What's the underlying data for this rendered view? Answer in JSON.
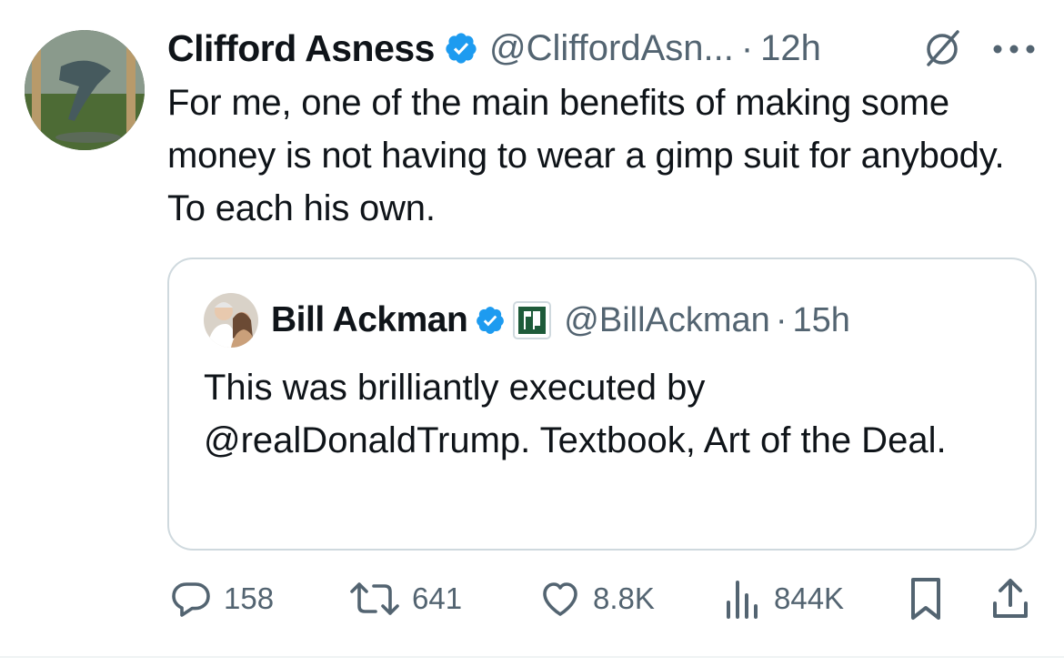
{
  "tweet": {
    "author_name": "Clifford Asness",
    "author_handle": "@CliffordAsn...",
    "separator": "·",
    "time": "12h",
    "text": "For me, one of the main benefits of making some money is not having to wear a gimp suit for anybody. To each his own."
  },
  "quoted_tweet": {
    "author_name": "Bill Ackman",
    "author_handle": "@BillAckman",
    "separator": "·",
    "time": "15h",
    "text": "This was brilliantly executed by @realDonaldTrump. Textbook, Art of the Deal."
  },
  "actions": {
    "replies": "158",
    "reposts": "641",
    "likes": "8.8K",
    "views": "844K"
  },
  "icons": {
    "verified": "verified-badge-icon",
    "grok": "grok-icon",
    "more": "more-icon",
    "affiliate": "affiliate-badge-icon",
    "reply": "reply-icon",
    "repost": "repost-icon",
    "like": "like-icon",
    "views": "views-icon",
    "bookmark": "bookmark-icon",
    "share": "share-icon"
  },
  "colors": {
    "verified_blue": "#1d9bf0",
    "muted_text": "#536471",
    "text": "#0f1419",
    "border": "#cfd9de",
    "affiliate_green": "#1e5b3a"
  }
}
